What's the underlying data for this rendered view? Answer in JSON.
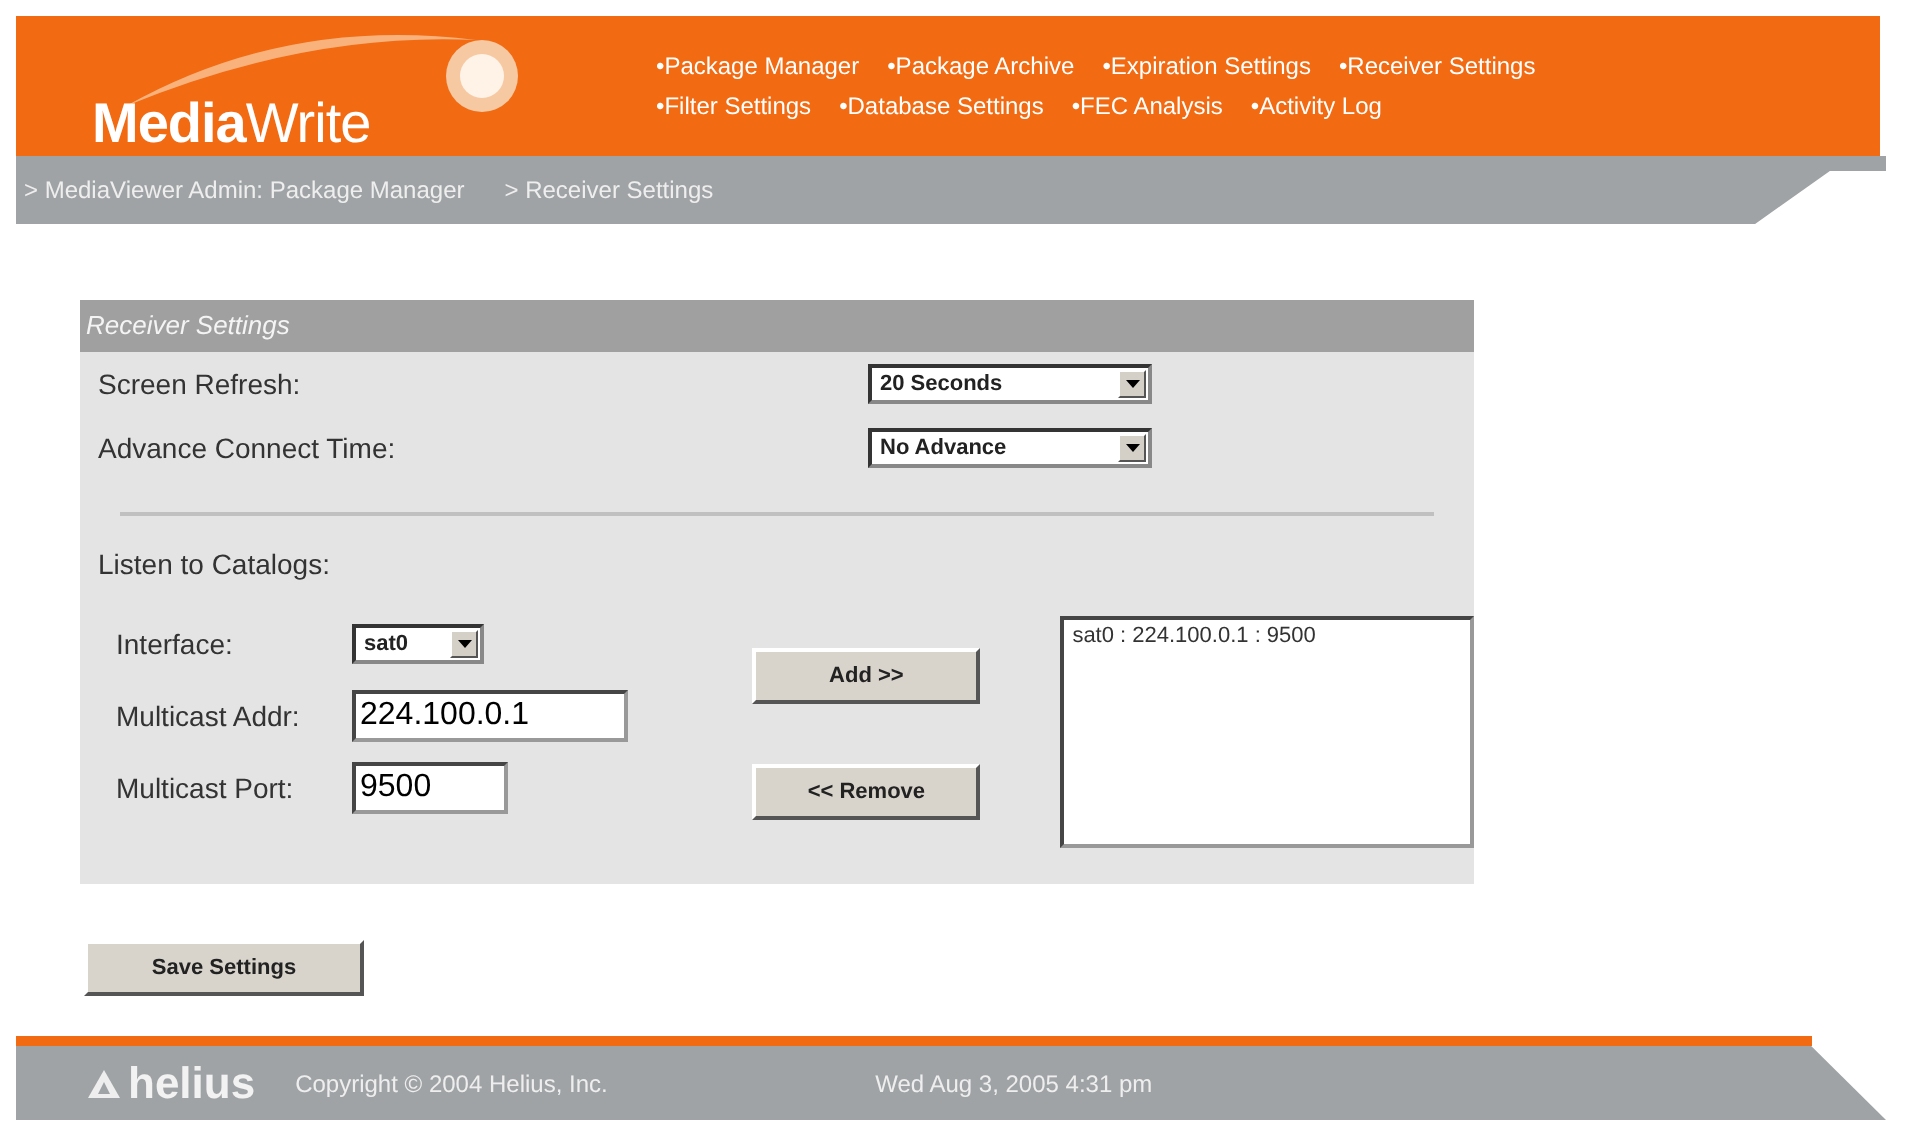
{
  "header": {
    "logo": "**Media**Write",
    "nav": [
      [
        "•Package Manager",
        "•Package Archive",
        "•Expiration Settings",
        "•Receiver Settings"
      ],
      [
        "•Filter Settings",
        "•Database Settings",
        "•FEC Analysis",
        "•Activity Log"
      ]
    ]
  },
  "breadcrumb": [
    "> MediaViewer Admin: Package Manager",
    "> Receiver Settings"
  ],
  "panel": {
    "title": "Receiver Settings",
    "settings": [
      {
        "label": "Screen Refresh:",
        "value": "20 Seconds"
      },
      {
        "label": "Advance Connect Time:",
        "value": "No Advance"
      }
    ],
    "catalogs_label": "Listen to Catalogs:",
    "interface": {
      "label": "Interface:",
      "value": "sat0"
    },
    "multicast_addr": {
      "label": "Multicast Addr:",
      "value": "224.100.0.1"
    },
    "multicast_port": {
      "label": "Multicast Port:",
      "value": "9500"
    },
    "add_button": "Add >>",
    "remove_button": "<< Remove",
    "catalog_list": [
      "sat0 : 224.100.0.1 : 9500"
    ]
  },
  "save_button": "Save Settings",
  "footer": {
    "brand": "helius",
    "copyright": "Copyright © 2004 Helius, Inc.",
    "datetime": "Wed Aug 3, 2005 4:31 pm"
  }
}
